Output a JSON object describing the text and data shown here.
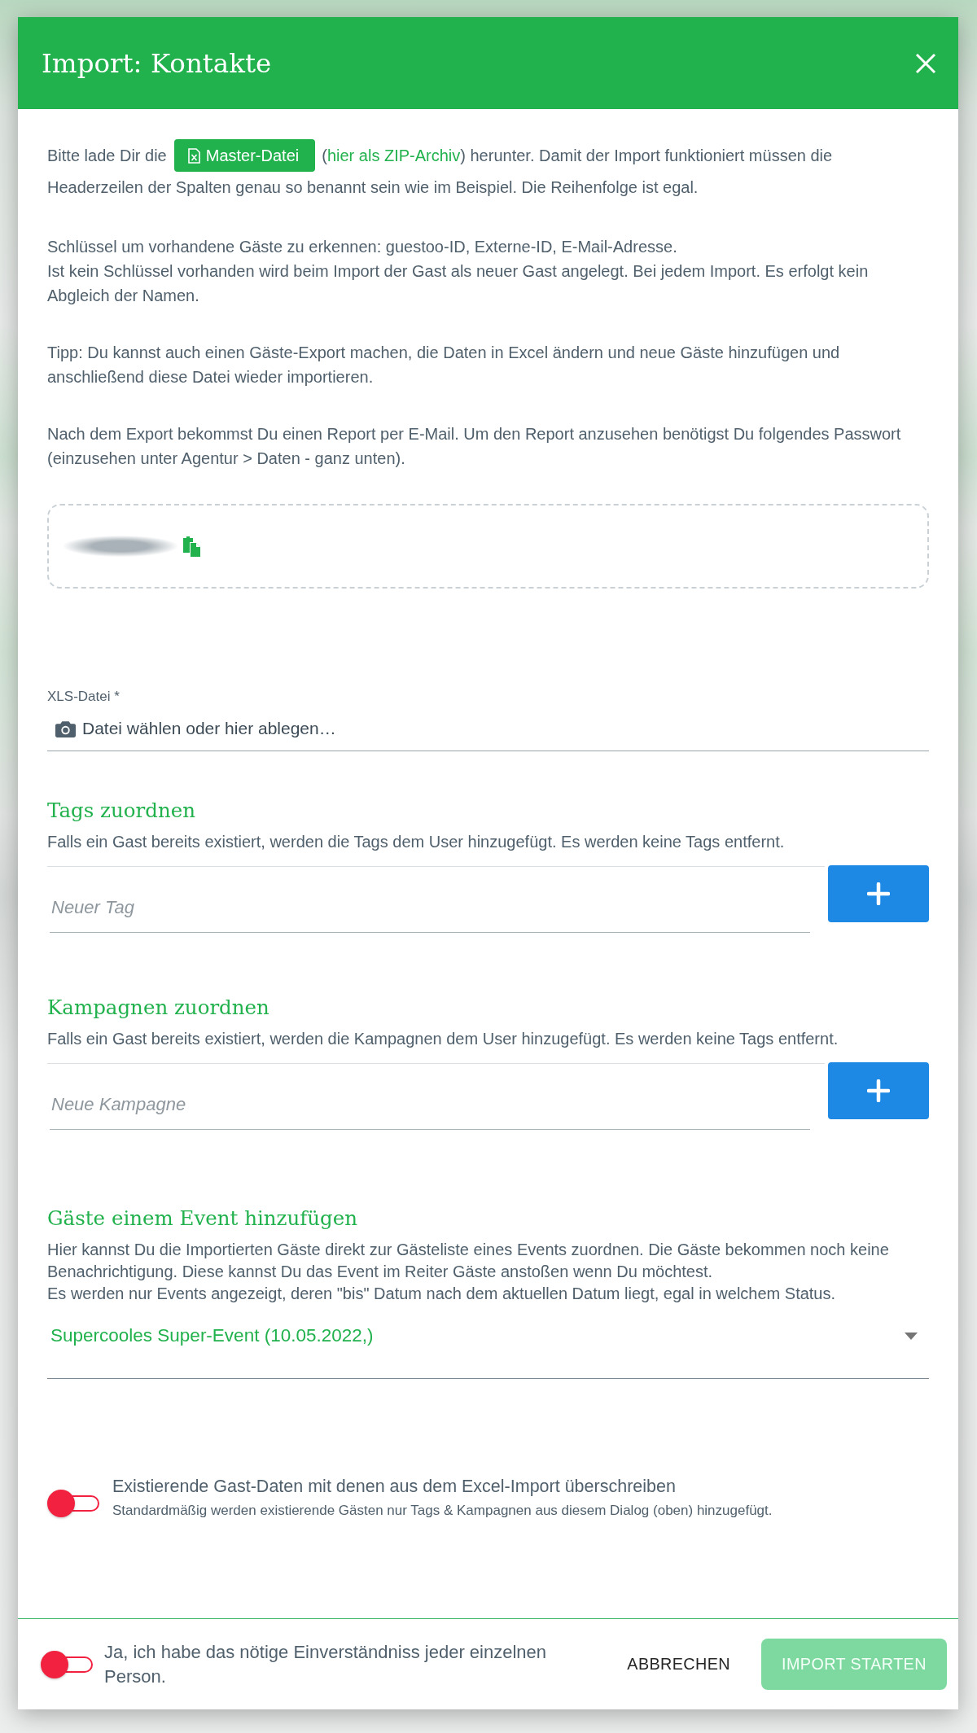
{
  "dialog": {
    "title": "Import: Kontakte"
  },
  "intro": {
    "segments": [
      {
        "kind": "text",
        "text": "Bitte lade Dir die"
      },
      {
        "kind": "button",
        "text": "Master-Datei"
      },
      {
        "kind": "text",
        "text": "("
      },
      {
        "kind": "link",
        "text": "hier als ZIP-Archiv"
      },
      {
        "kind": "text",
        "text": ") herunter. Damit der Import funktioniert müssen die Headerzeilen der Spalten genau so benannt sein wie im Beispiel. Die Reihenfolge ist egal."
      }
    ]
  },
  "paragraphs": [
    {
      "lines": [
        "Schlüssel um vorhandene Gäste zu erkennen: guestoo-ID, Externe-ID, E-Mail-Adresse.",
        "Ist kein Schlüssel vorhanden wird beim Import der Gast als neuer Gast angelegt. Bei jedem Import. Es erfolgt kein Abgleich der Namen."
      ]
    },
    {
      "lines": [
        "Tipp: Du kannst auch einen Gäste-Export machen, die Daten in Excel ändern und neue Gäste hinzufügen und anschließend diese Datei wieder importieren."
      ]
    },
    {
      "lines": [
        "Nach dem Export bekommst Du einen Report per E-Mail. Um den Report anzusehen benötigst Du folgendes Passwort (einzusehen unter Agentur > Daten - ganz unten)."
      ]
    }
  ],
  "file_field": {
    "label": "XLS-Datei *",
    "placeholder": "Datei wählen oder hier ablegen…"
  },
  "sections": [
    {
      "heading": "Tags zuordnen",
      "description": "Falls ein Gast bereits existiert, werden die Tags dem User hinzugefügt. Es werden keine Tags entfernt.",
      "input": {
        "placeholder": "Neuer Tag"
      }
    },
    {
      "heading": "Kampagnen zuordnen",
      "description": "Falls ein Gast bereits existiert, werden die Kampagnen dem User hinzugefügt. Es werden keine Tags entfernt.",
      "input": {
        "placeholder": "Neue Kampagne"
      }
    }
  ],
  "event": {
    "heading": "Gäste einem Event hinzufügen",
    "description_lines": [
      "Hier kannst Du die Importierten Gäste direkt zur Gästeliste eines Events zuordnen. Die Gäste bekommen noch keine Benachrichtigung. Diese kannst Du das Event im Reiter Gäste anstoßen wenn Du möchtest.",
      "Es werden nur Events angezeigt, deren \"bis\" Datum nach dem aktuellen Datum liegt, egal in welchem Status."
    ],
    "select": {
      "value": "Supercooles Super-Event (10.05.2022,)"
    }
  },
  "overwrite": {
    "label": "Existierende Gast-Daten mit denen aus dem Excel-Import überschreiben",
    "hint": "Standardmäßig werden existierende Gästen nur Tags & Kampagnen aus diesem Dialog (oben) hinzugefügt.",
    "on": false
  },
  "footer": {
    "consent": {
      "label": "Ja, ich habe das nötige Einverständniss jeder einzelnen Person.",
      "on": false
    },
    "buttons": [
      {
        "kind": "text",
        "label": "ABBRECHEN",
        "disabled": false
      },
      {
        "kind": "raised",
        "label": "IMPORT STARTEN",
        "disabled": true
      }
    ]
  }
}
